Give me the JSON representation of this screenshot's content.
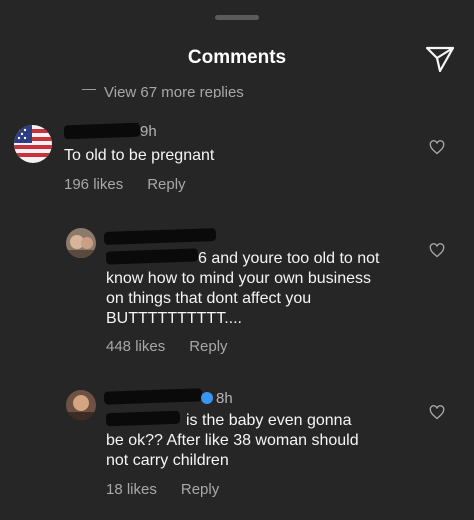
{
  "header": {
    "title": "Comments"
  },
  "thread": {
    "view_more_replies": "View 67 more replies"
  },
  "comments": [
    {
      "time": "9h",
      "text": "To old to be pregnant",
      "likes": "196 likes",
      "reply": "Reply"
    },
    {
      "lines": [
        "6 and youre too old to not",
        "know how to mind your own business",
        "on things that dont affect you",
        "BUTTTTTTTTTT...."
      ],
      "likes": "448 likes",
      "reply": "Reply"
    },
    {
      "time": "8h",
      "lines": [
        "is the baby even gonna",
        "be ok?? After like 38 woman should",
        "not carry children"
      ],
      "likes": "18 likes",
      "reply": "Reply"
    }
  ],
  "colors": {
    "background": "#262626",
    "text": "#f5f5f5",
    "secondary_text": "#a8a8a8",
    "verified": "#3897f0"
  },
  "icons": {
    "share": "paper-plane-icon",
    "like": "heart-outline-icon",
    "verified": "verified-badge-icon"
  }
}
